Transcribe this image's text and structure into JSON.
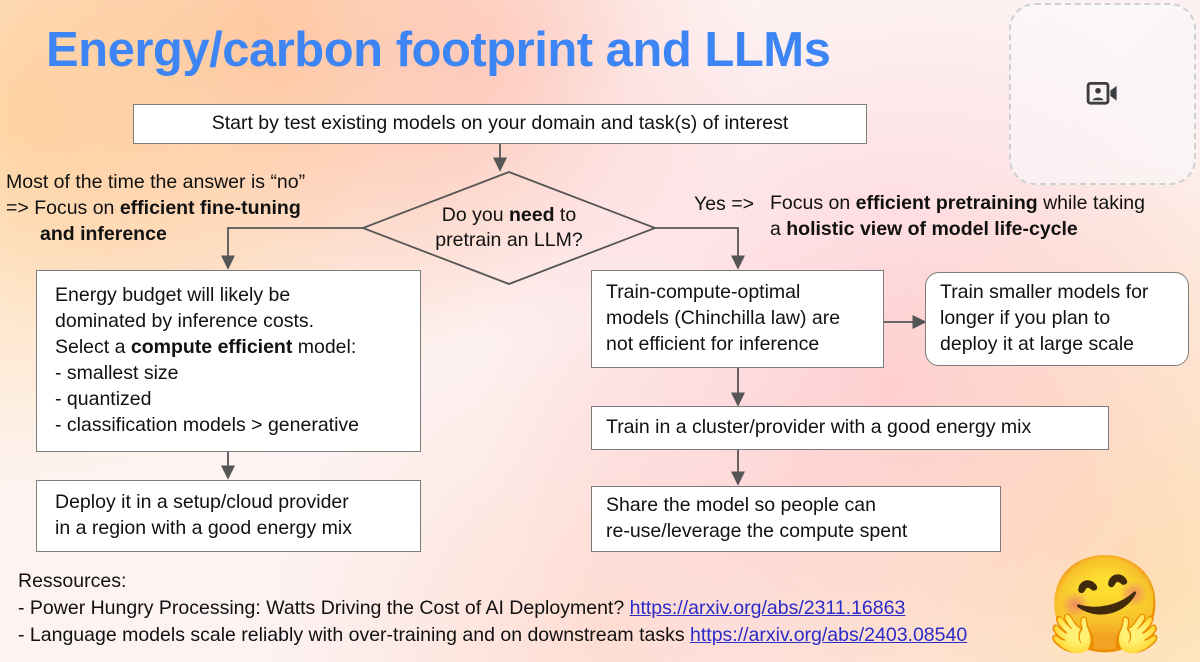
{
  "slide": {
    "title": "Energy/carbon footprint and LLMs",
    "title_color": "#3d85f5"
  },
  "video_placeholder": {
    "icon": "person-video-icon"
  },
  "flow": {
    "start_box": "Start by test existing models on your domain and task(s) of interest",
    "decision": {
      "line1_pre": "Do you ",
      "line1_bold": "need",
      "line1_post": " to",
      "line2": "pretrain an LLM?"
    },
    "left_annotation": {
      "line1": "Most of the time the answer is “no”",
      "line2_pre": "=> Focus on ",
      "line2_bold": "efficient fine-tuning",
      "line3_bold": "and inference"
    },
    "right_annotation": {
      "yes_label": "Yes =>",
      "line1_pre": "Focus on ",
      "line1_bold": "efficient pretraining",
      "line1_post": " while taking",
      "line2_pre": "a ",
      "line2_bold": "holistic view of model life-cycle"
    },
    "energy_box": {
      "l1": "Energy budget will likely be",
      "l2": "dominated by inference costs.",
      "l3_pre": "Select a ",
      "l3_bold": "compute efficient",
      "l3_post": " model:",
      "l4": "- smallest size",
      "l5": "- quantized",
      "l6": "- classification models > generative"
    },
    "deploy_box": {
      "l1": "Deploy it in a setup/cloud provider",
      "l2": "in a region with a good energy mix"
    },
    "chinchilla_box": {
      "l1": "Train-compute-optimal",
      "l2": "models (Chinchilla law) are",
      "l3": "not efficient for inference"
    },
    "smaller_models_box": {
      "l1": "Train smaller models for",
      "l2": "longer if you plan to",
      "l3": "deploy it at large scale"
    },
    "cluster_box": "Train in a cluster/provider with a good energy mix",
    "share_box": {
      "l1": "Share the model so people can",
      "l2": "re-use/leverage the compute spent"
    }
  },
  "resources": {
    "heading": "Ressources:",
    "item1_text": "- Power Hungry Processing: Watts Driving the Cost of AI Deployment? ",
    "item1_link": "https://arxiv.org/abs/2311.16863",
    "item2_text": "- Language models scale reliably with over-training and on downstream tasks ",
    "item2_link": "https://arxiv.org/abs/2403.08540",
    "link_color": "#2b2bc8"
  },
  "branding": {
    "hugging_face_emoji": "🤗"
  }
}
